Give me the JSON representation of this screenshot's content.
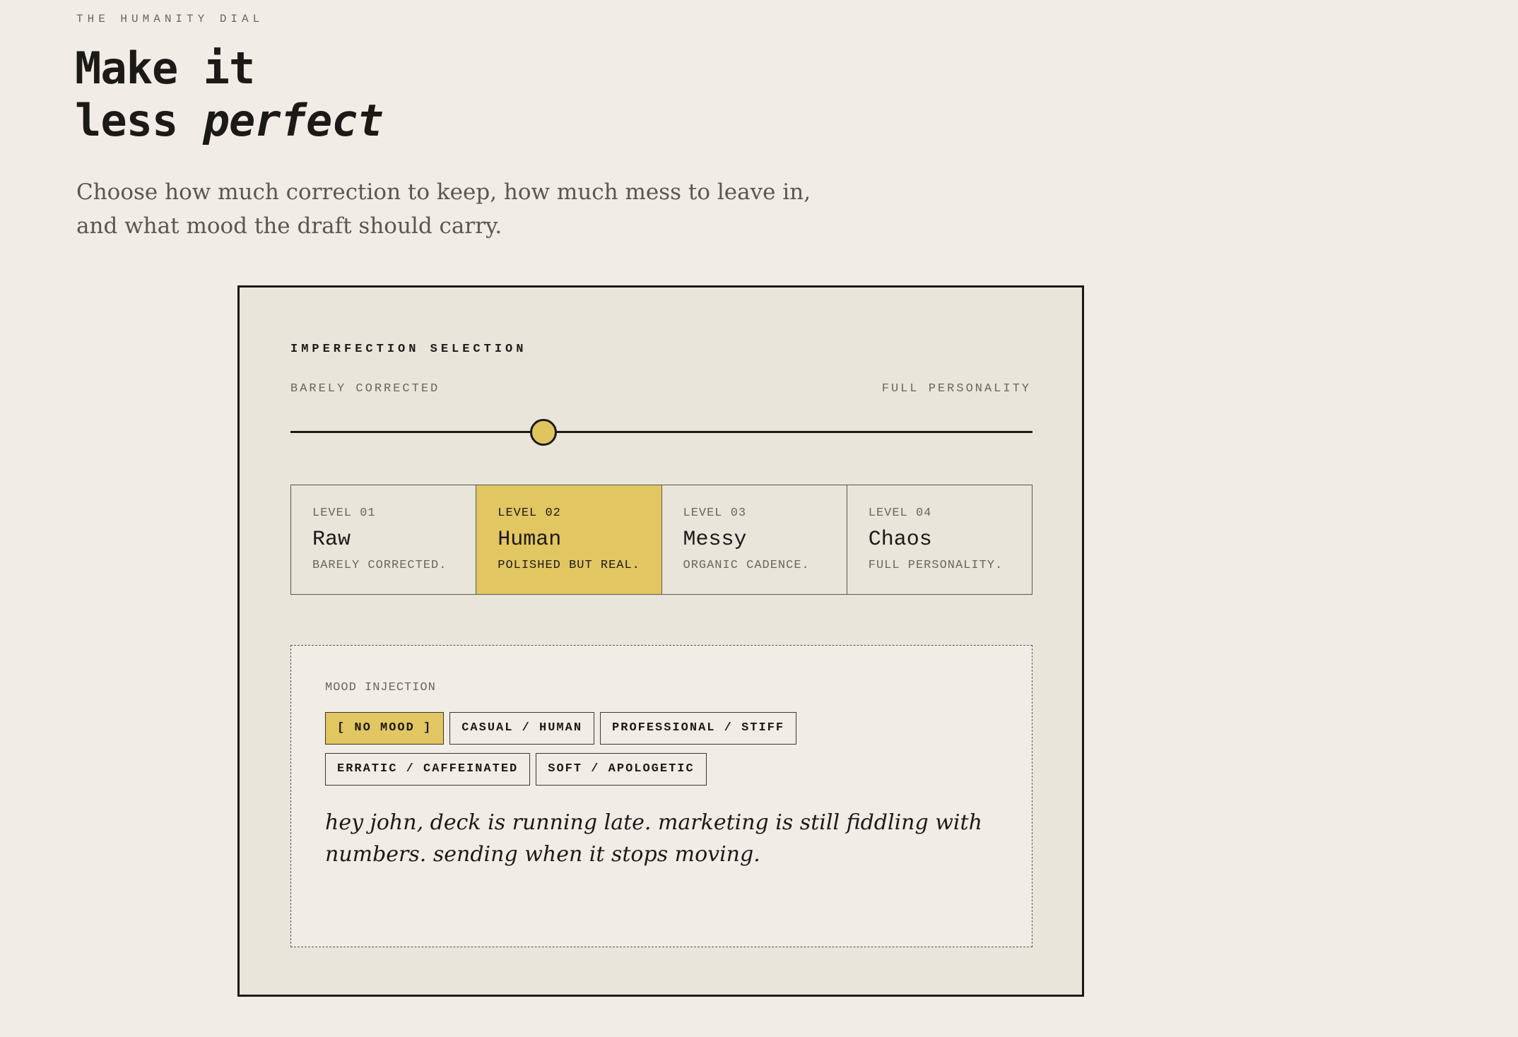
{
  "header": {
    "eyebrow": "THE HUMANITY DIAL",
    "title_line1": "Make it",
    "title_line2_plain": "less ",
    "title_line2_emph": "perfect",
    "lede": "Choose how much correction to keep, how much mess to leave in, and what mood the draft should carry."
  },
  "panel": {
    "title": "IMPERFECTION SELECTION",
    "scale_left": "BARELY CORRECTED",
    "scale_right": "FULL PERSONALITY",
    "slider_value": 0.34,
    "levels": [
      {
        "tag": "LEVEL 01",
        "name": "Raw",
        "desc": "BARELY CORRECTED."
      },
      {
        "tag": "LEVEL 02",
        "name": "Human",
        "desc": "POLISHED BUT REAL."
      },
      {
        "tag": "LEVEL 03",
        "name": "Messy",
        "desc": "ORGANIC CADENCE."
      },
      {
        "tag": "LEVEL 04",
        "name": "Chaos",
        "desc": "FULL PERSONALITY."
      }
    ],
    "active_level": 1
  },
  "mood": {
    "label": "MOOD INJECTION",
    "chips": [
      {
        "label": "[ NO MOOD ]",
        "active": true
      },
      {
        "label": "CASUAL / HUMAN",
        "active": false
      },
      {
        "label": "PROFESSIONAL / STIFF",
        "active": false
      },
      {
        "label": "ERRATIC / CAFFEINATED",
        "active": false
      },
      {
        "label": "SOFT / APOLOGETIC",
        "active": false
      }
    ],
    "preview_text": "hey john, deck is running late. marketing is still fiddling with numbers. sending when it stops moving."
  },
  "colors": {
    "background": "#f1ede6",
    "panel": "#e9e5db",
    "accent": "#e2c662",
    "ink": "#1c1a17",
    "muted": "#6b665d"
  }
}
